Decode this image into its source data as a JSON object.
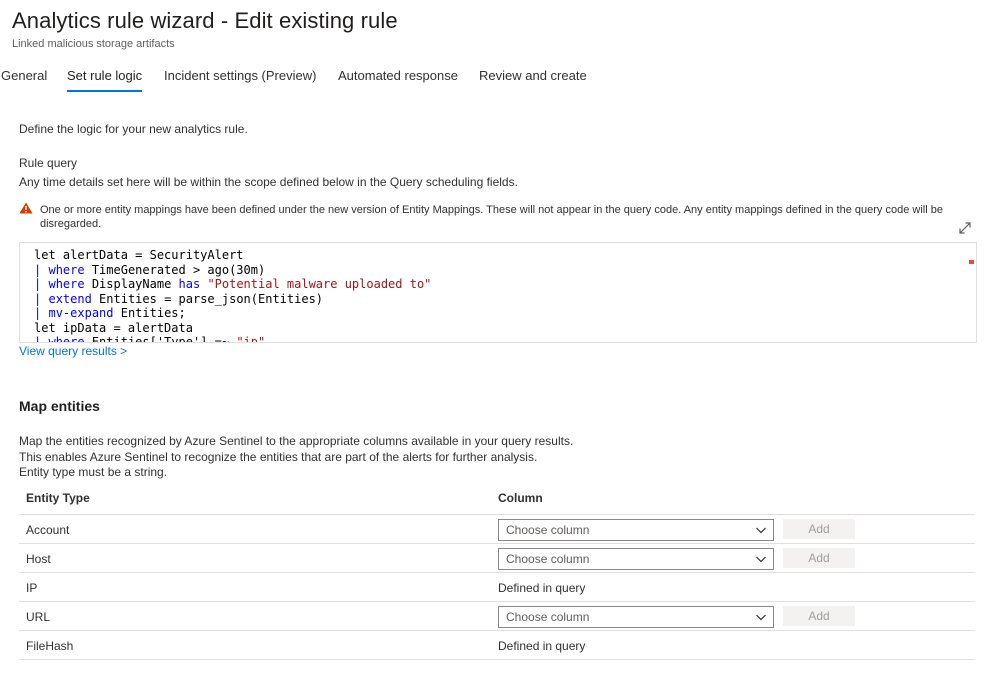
{
  "header": {
    "title": "Analytics rule wizard - Edit existing rule",
    "subtitle": "Linked malicious storage artifacts"
  },
  "tabs": [
    {
      "label": "General",
      "active": false
    },
    {
      "label": "Set rule logic",
      "active": true
    },
    {
      "label": "Incident settings (Preview)",
      "active": false
    },
    {
      "label": "Automated response",
      "active": false
    },
    {
      "label": "Review and create",
      "active": false
    }
  ],
  "main": {
    "intro": "Define the logic for your new analytics rule.",
    "rule_query_label": "Rule query",
    "rule_query_help": "Any time details set here will be within the scope defined below in the Query scheduling fields.",
    "warning": "One or more entity mappings have been defined under the new version of Entity Mappings. These will not appear in the query code. Any entity mappings defined in the query code will be disregarded.",
    "view_results_link": "View query results >"
  },
  "query": {
    "lines": [
      "let alertData = SecurityAlert",
      "| where TimeGenerated > ago(30m)",
      "| where DisplayName has \"Potential malware uploaded to\"",
      "| extend Entities = parse_json(Entities)",
      "| mv-expand Entities;",
      "let ipData = alertData",
      "| where Entities['Type'] =~ \"ip\""
    ]
  },
  "map_entities": {
    "title": "Map entities",
    "desc_lines": [
      "Map the entities recognized by Azure Sentinel to the appropriate columns available in your query results.",
      "This enables Azure Sentinel to recognize the entities that are part of the alerts for further analysis.",
      "Entity type must be a string."
    ],
    "col_entity_type": "Entity Type",
    "col_column": "Column",
    "rows": [
      {
        "entity": "Account",
        "mode": "select",
        "value": "Choose column",
        "button": "Add"
      },
      {
        "entity": "Host",
        "mode": "select",
        "value": "Choose column",
        "button": "Add"
      },
      {
        "entity": "IP",
        "mode": "text",
        "value": "Defined in query"
      },
      {
        "entity": "URL",
        "mode": "select",
        "value": "Choose column",
        "button": "Add"
      },
      {
        "entity": "FileHash",
        "mode": "text",
        "value": "Defined in query"
      }
    ]
  },
  "colors": {
    "accent": "#0078d4",
    "warning": "#d83b01",
    "keyword": "#0000ff",
    "string": "#a31515"
  },
  "icons": {
    "warning": "warning-icon",
    "expand": "expand-icon",
    "dropdown": "chevron-down-icon"
  }
}
